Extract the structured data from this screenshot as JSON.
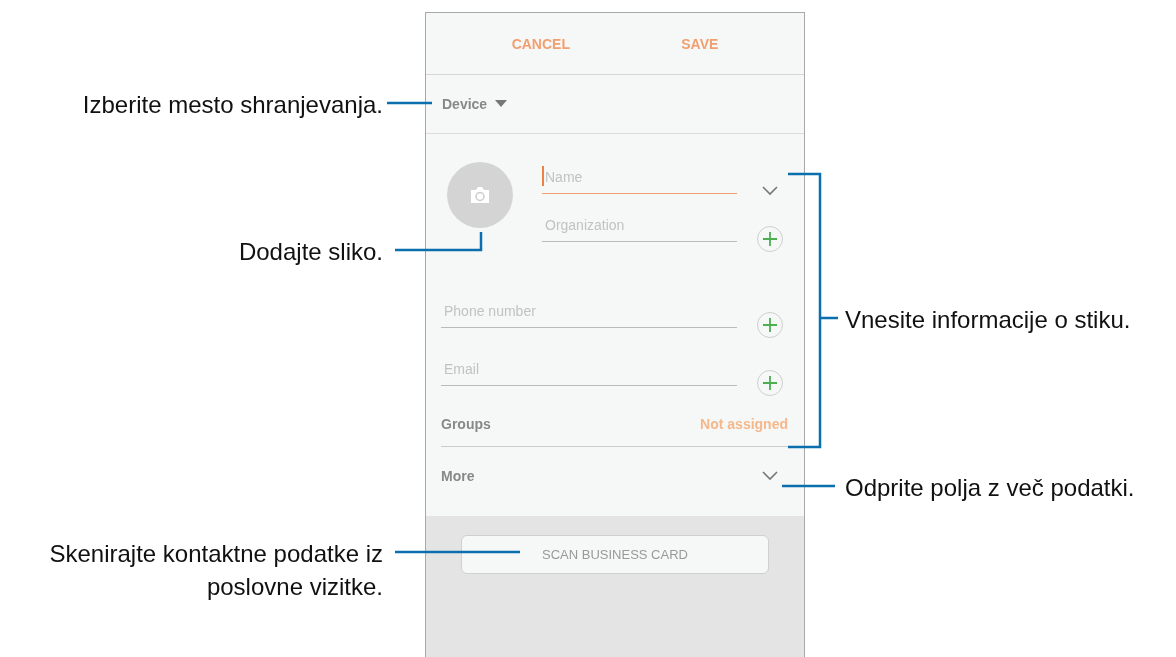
{
  "screen": {
    "header": {
      "cancel": "CANCEL",
      "save": "SAVE"
    },
    "storage": {
      "value": "Device"
    },
    "name_fields": [
      {
        "placeholder": "Name",
        "focused": true,
        "kind": "expand"
      },
      {
        "placeholder": "Organization",
        "focused": false,
        "kind": "add"
      }
    ],
    "contact_fields": [
      {
        "placeholder": "Phone number",
        "focused": false,
        "kind": "add"
      },
      {
        "placeholder": "Email",
        "focused": false,
        "kind": "add"
      }
    ],
    "groups": {
      "label": "Groups",
      "value": "Not assigned"
    },
    "more": {
      "label": "More"
    },
    "scan_button": "SCAN BUSINESS CARD"
  },
  "callouts": [
    {
      "text": "Izberite mesto shranjevanja."
    },
    {
      "text": "Dodajte sliko."
    },
    {
      "text": "Skenirajte kontaktne podatke iz poslovne vizitke."
    },
    {
      "text": "Vnesite informacije o stiku."
    },
    {
      "text": "Odprite polja z več podatki."
    }
  ]
}
